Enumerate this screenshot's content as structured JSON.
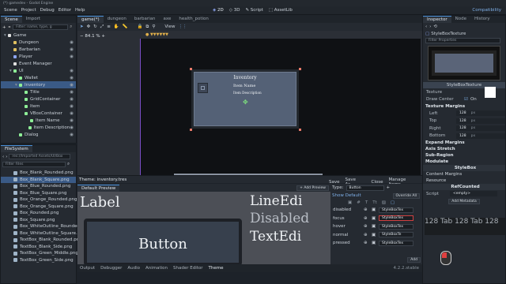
{
  "window": {
    "title": "(*) gamedev - Godot Engine"
  },
  "menu": [
    "Scene",
    "Project",
    "Debug",
    "Editor",
    "Help"
  ],
  "workspaces": [
    {
      "label": "2D",
      "icon": "2d-icon"
    },
    {
      "label": "3D",
      "icon": "3d-icon"
    },
    {
      "label": "Script",
      "icon": "script-icon"
    },
    {
      "label": "AssetLib",
      "icon": "assetlib-icon"
    }
  ],
  "renderer": "Compatibility",
  "scene_dock": {
    "tabs": [
      "Scene",
      "Import"
    ],
    "filter_placeholder": "Filter: name, type, g",
    "nodes": [
      {
        "label": "Game",
        "depth": 0,
        "color": "#e0e0e0"
      },
      {
        "label": "Dungeon",
        "depth": 1,
        "color": "#e0c060"
      },
      {
        "label": "Barbarian",
        "depth": 1,
        "color": "#e0c060"
      },
      {
        "label": "Player",
        "depth": 1,
        "color": "#8da5f3"
      },
      {
        "label": "Event Manager",
        "depth": 1,
        "color": "#e0e0e0"
      },
      {
        "label": "UI",
        "depth": 1,
        "color": "#8eef97"
      },
      {
        "label": "Wallet",
        "depth": 2,
        "color": "#8eef97"
      },
      {
        "label": "Inventory",
        "depth": 2,
        "color": "#8eef97",
        "selected": true
      },
      {
        "label": "Title",
        "depth": 3,
        "color": "#8eef97"
      },
      {
        "label": "GridContainer",
        "depth": 3,
        "color": "#8eef97"
      },
      {
        "label": "Item",
        "depth": 3,
        "color": "#8eef97"
      },
      {
        "label": "VBoxContainer",
        "depth": 3,
        "color": "#8eef97"
      },
      {
        "label": "Item Name",
        "depth": 4,
        "color": "#8eef97"
      },
      {
        "label": "Item Description",
        "depth": 4,
        "color": "#8eef97"
      },
      {
        "label": "Dialog",
        "depth": 2,
        "color": "#8eef97"
      }
    ]
  },
  "filesystem": {
    "tab": "FileSystem",
    "path": "res://Imported Assets/UI/Box",
    "filter_placeholder": "Filter Files",
    "files": [
      {
        "label": "Box_Blank_Rounded.png"
      },
      {
        "label": "Box_Blank_Square.png",
        "selected": true
      },
      {
        "label": "Box_Blue_Rounded.png"
      },
      {
        "label": "Box_Blue_Square.png"
      },
      {
        "label": "Box_Orange_Rounded.png"
      },
      {
        "label": "Box_Orange_Square.png"
      },
      {
        "label": "Box_Rounded.png"
      },
      {
        "label": "Box_Square.png"
      },
      {
        "label": "Box_WhiteOutline_Rounded.png"
      },
      {
        "label": "Box_WhiteOutline_Square.png"
      },
      {
        "label": "TextBox_Blank_Rounded.png"
      },
      {
        "label": "TextBox_Blank_Side.png"
      },
      {
        "label": "TextBox_Green_Middle.png"
      },
      {
        "label": "TextBox_Green_Side.png"
      }
    ]
  },
  "editor_tabs": [
    {
      "label": "game(*)",
      "active": true
    },
    {
      "label": "dungeon"
    },
    {
      "label": "barbarian"
    },
    {
      "label": "axe"
    },
    {
      "label": "health_potion"
    }
  ],
  "viewport": {
    "zoom": "84.1 %",
    "toolbar_view": "View",
    "inventory_panel": {
      "title": "Inventory",
      "item_name": "Item Name",
      "item_description": "Item Description"
    }
  },
  "theme_panel": {
    "header": "Theme: inventory.tres",
    "save": "Save",
    "save_as": "Save As...",
    "close": "Close",
    "manage": "Manage Items...",
    "default_preview": "Default Preview",
    "add_preview": "+ Add Preview",
    "type_label": "Type:",
    "type_value": "Button",
    "show_default": "Show Default",
    "override_all": "Override All",
    "states": [
      {
        "label": "disabled",
        "value": "StyleBoxTex"
      },
      {
        "label": "focus",
        "value": "StyleBoxTex",
        "highlight": true
      },
      {
        "label": "hover",
        "value": "StyleBoxTex"
      },
      {
        "label": "normal",
        "value": "StyleBoxTe"
      },
      {
        "label": "pressed",
        "value": "StyleBoxTex"
      }
    ],
    "add": "Add",
    "preview_texts": {
      "label": "Label",
      "button": "Button",
      "line_edit": "LineEdi",
      "disabled": "Disabled",
      "text_edit": "TextEdi"
    }
  },
  "bottom_tabs": [
    "Output",
    "Debugger",
    "Audio",
    "Animation",
    "Shader Editor",
    "Theme"
  ],
  "version": "4.2.2.stable",
  "inspector": {
    "tabs": [
      "Inspector",
      "Node",
      "History"
    ],
    "resource_name": "StyleBoxTexture",
    "filter_placeholder": "Filter Properties",
    "resource_label": "StyleBoxTexture",
    "texture_label": "Texture",
    "draw_center": {
      "label": "Draw Center",
      "value": "On"
    },
    "texture_margins": {
      "title": "Texture Margins",
      "rows": [
        {
          "label": "Left",
          "value": "128",
          "unit": "px"
        },
        {
          "label": "Top",
          "value": "128",
          "unit": "px"
        },
        {
          "label": "Right",
          "value": "128",
          "unit": "px"
        },
        {
          "label": "Bottom",
          "value": "128",
          "unit": "px"
        }
      ]
    },
    "sections": [
      "Expand Margins",
      "Axis Stretch",
      "Sub-Region",
      "Modulate"
    ],
    "stylebox_section": "StyleBox",
    "content_margins": "Content Margins",
    "resource_section": "Resource",
    "refcounted": "RefCounted",
    "script_label": "Script",
    "script_value": "<empty>",
    "add_metadata": "Add Metadata",
    "overlay_text": "128 Tab 128 Tab 128"
  },
  "colors": {
    "accent": "#4a90d9",
    "selection": "#3a5a86",
    "inventory_panel_bg": "#546176",
    "inventory_panel_border": "#24292f"
  }
}
